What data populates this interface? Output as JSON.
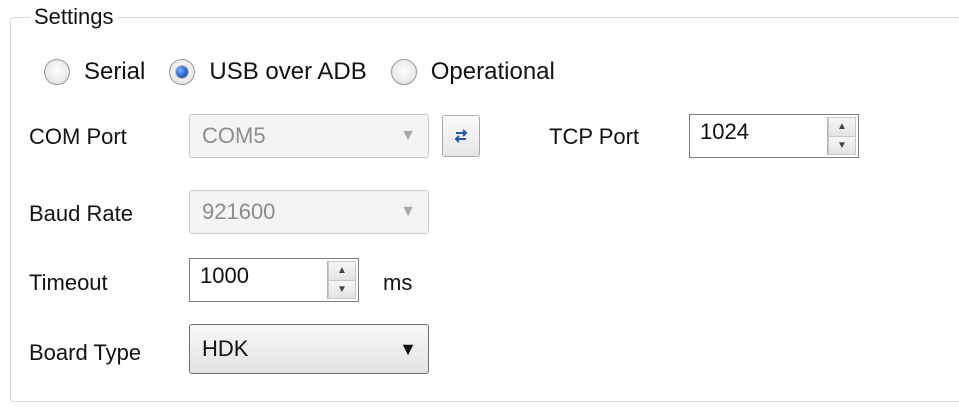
{
  "settings": {
    "group_title": "Settings",
    "connection_modes": [
      {
        "label": "Serial",
        "selected": false
      },
      {
        "label": "USB over ADB",
        "selected": true
      },
      {
        "label": "Operational",
        "selected": false
      }
    ],
    "com_port": {
      "label": "COM Port",
      "value": "COM5",
      "enabled": false
    },
    "baud_rate": {
      "label": "Baud Rate",
      "value": "921600",
      "enabled": false
    },
    "timeout": {
      "label": "Timeout",
      "value": "1000",
      "unit": "ms"
    },
    "board_type": {
      "label": "Board Type",
      "value": "HDK",
      "enabled": true
    },
    "tcp_port": {
      "label": "TCP Port",
      "value": "1024"
    }
  },
  "icons": {
    "refresh": "refresh-icon",
    "dropdown": "chevron-down-icon",
    "spin_up": "spin-up-icon",
    "spin_down": "spin-down-icon"
  },
  "colors": {
    "accent": "#2a66c6",
    "disabled_text": "#8d8d8d"
  }
}
